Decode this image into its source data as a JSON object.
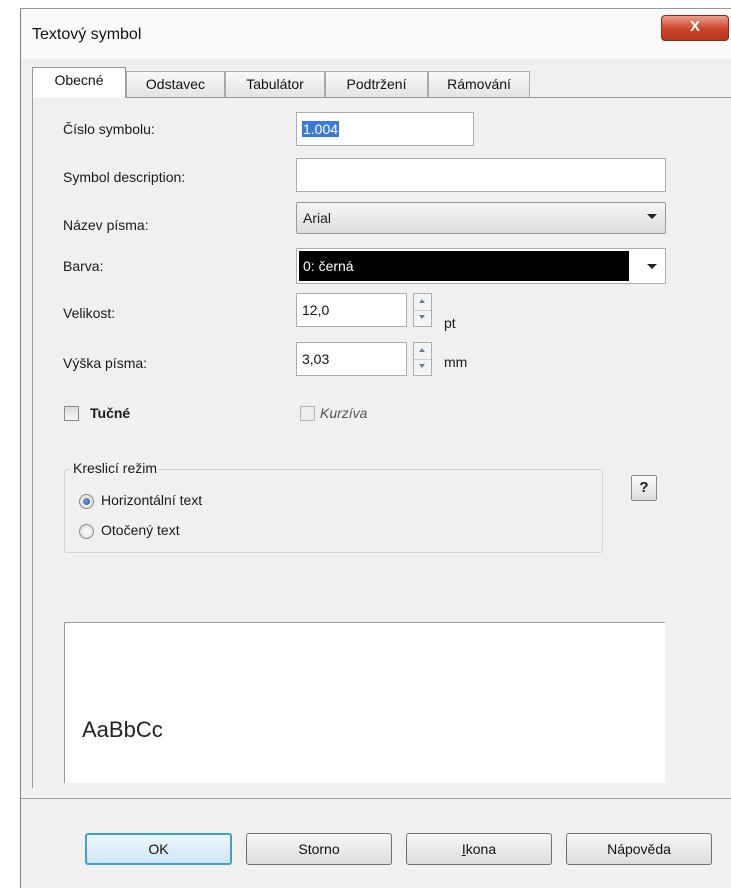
{
  "window": {
    "title": "Textový symbol",
    "close_glyph": "X"
  },
  "tabs": [
    "Obecné",
    "Odstavec",
    "Tabulátor",
    "Podtržení",
    "Rámování"
  ],
  "form": {
    "symbol_number_label": "Číslo symbolu:",
    "symbol_number_value": "1.004",
    "symbol_description_label": "Symbol description:",
    "symbol_description_value": "",
    "font_name_label": "Název písma:",
    "font_name_value": "Arial",
    "color_label": "Barva:",
    "color_value": "0: černá",
    "size_label": "Velikost:",
    "size_value": "12,0",
    "size_unit": "pt",
    "font_height_label": "Výška písma:",
    "font_height_value": "3,03",
    "font_height_unit": "mm",
    "bold_label": "Tučné",
    "italic_label": "Kurzíva"
  },
  "drawing_mode": {
    "legend": "Kreslicí režim",
    "options": [
      "Horizontální text",
      "Otočený text"
    ],
    "selected": "Horizontální text"
  },
  "help_button": "?",
  "preview": {
    "sample": "AaBbCc"
  },
  "buttons": {
    "ok": "OK",
    "cancel": "Storno",
    "icon_prefix": "I",
    "icon_rest": "kona",
    "help": "Nápověda"
  },
  "colors": {
    "close": "#c9432a",
    "selection": "#3a7bd5",
    "color_swatch": "#000000",
    "default_button": "#3c9fd8"
  }
}
